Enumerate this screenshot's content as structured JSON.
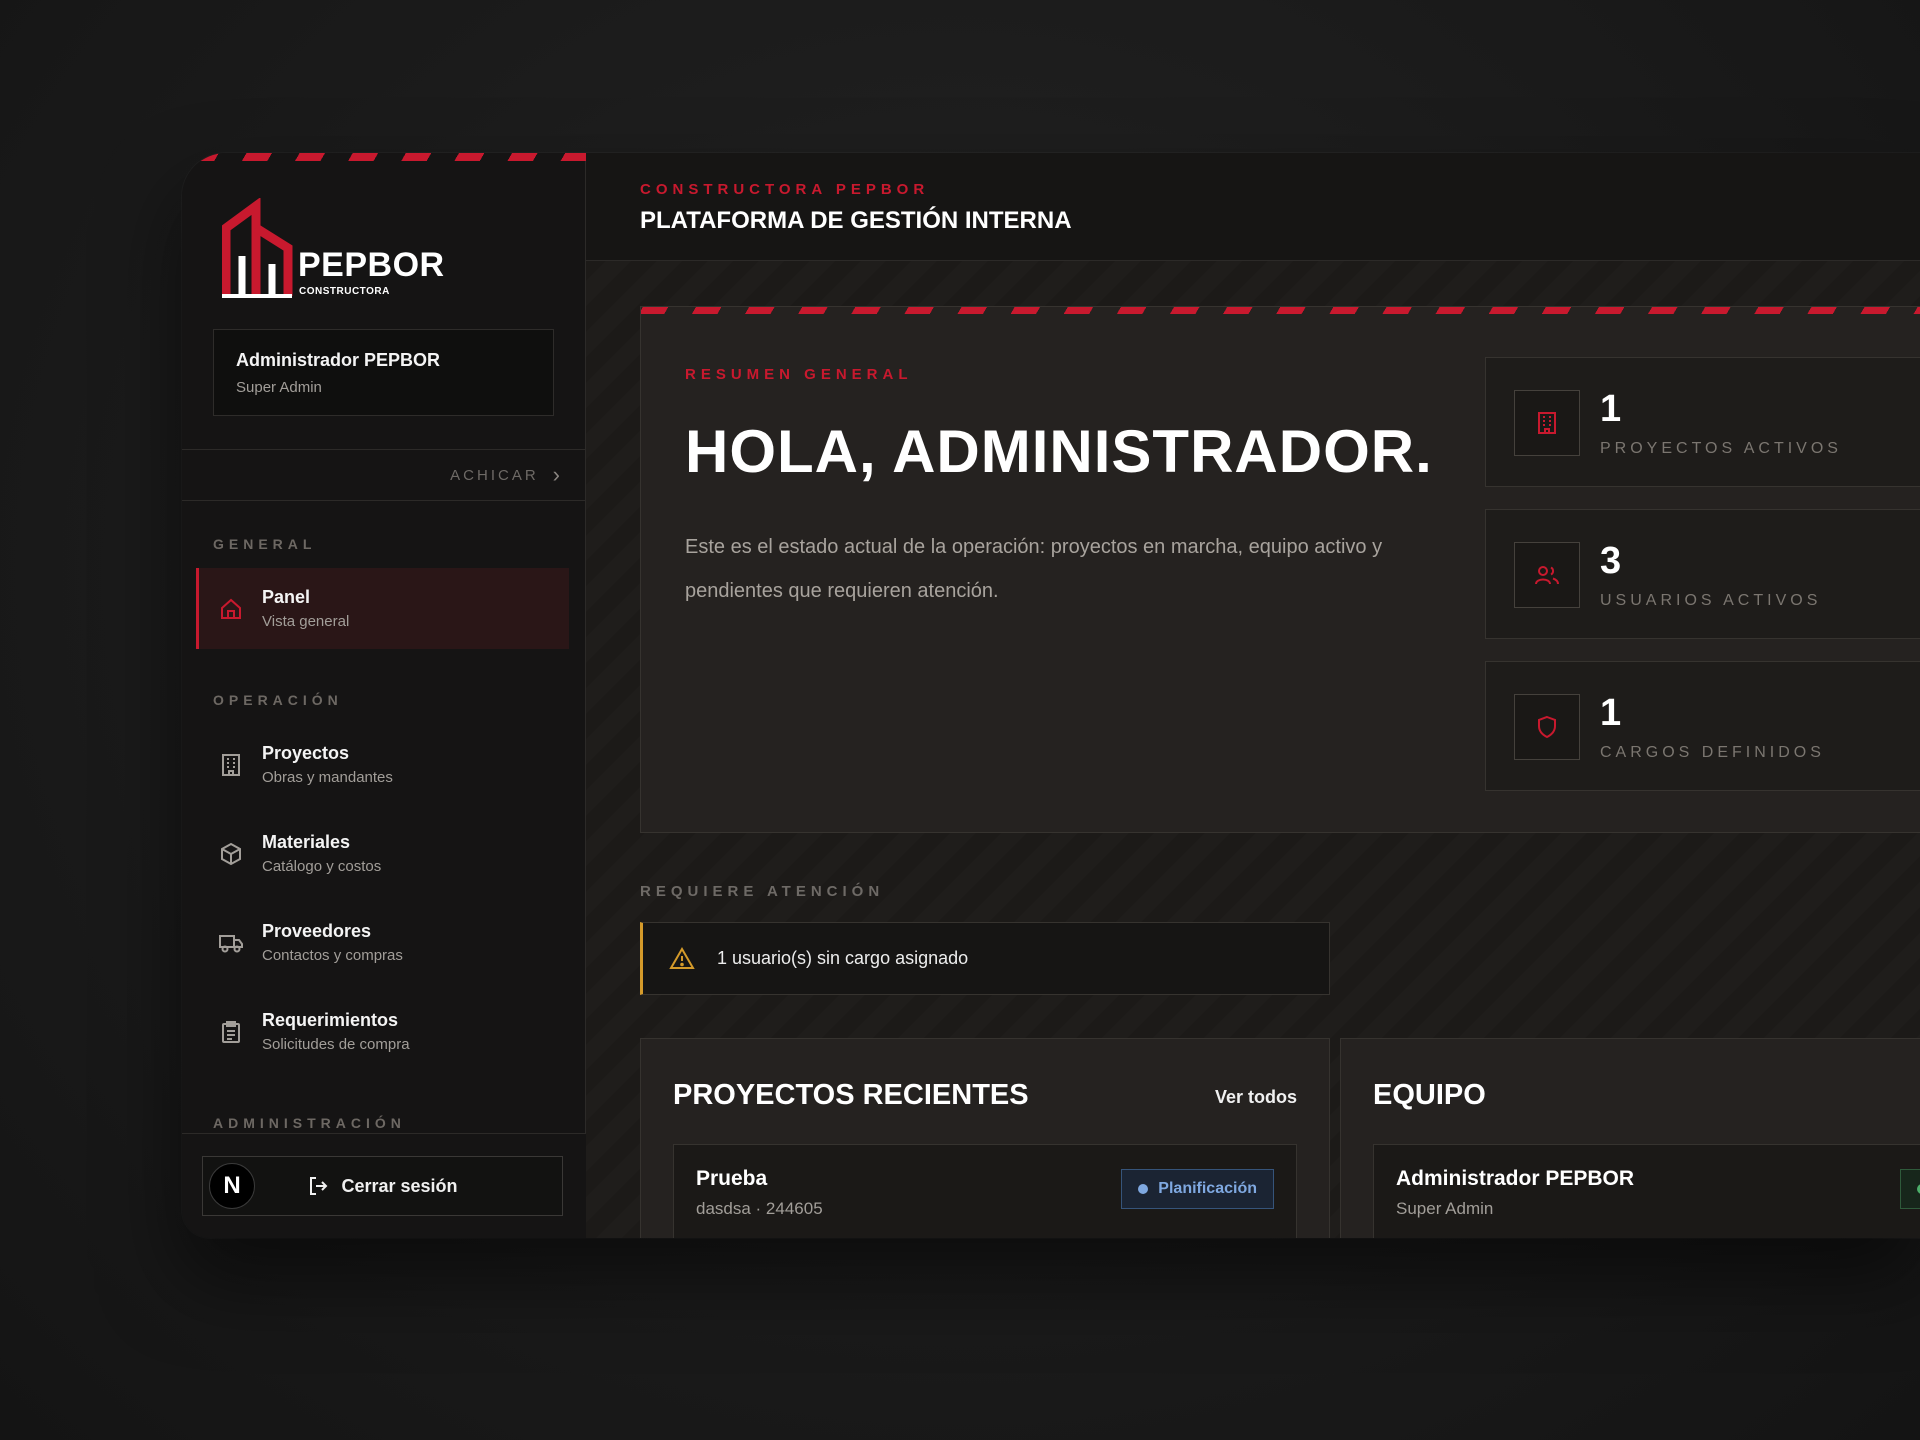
{
  "brand": {
    "wordmark": "PEPBOR",
    "tagline": "CONSTRUCTORA",
    "accent": "#c8192e"
  },
  "user": {
    "name": "Administrador PEPBOR",
    "role": "Super Admin"
  },
  "sidebar": {
    "collapse_label": "ACHICAR",
    "sections": {
      "general": "GENERAL",
      "operacion": "OPERACIÓN",
      "administracion": "ADMINISTRACIÓN"
    },
    "items": [
      {
        "title": "Panel",
        "subtitle": "Vista general",
        "icon": "home-icon",
        "active": true
      },
      {
        "title": "Proyectos",
        "subtitle": "Obras y mandantes",
        "icon": "building-icon"
      },
      {
        "title": "Materiales",
        "subtitle": "Catálogo y costos",
        "icon": "box-icon"
      },
      {
        "title": "Proveedores",
        "subtitle": "Contactos y compras",
        "icon": "truck-icon"
      },
      {
        "title": "Requerimientos",
        "subtitle": "Solicitudes de compra",
        "icon": "clipboard-icon"
      }
    ],
    "avatar_letter": "N",
    "logout_label": "Cerrar sesión"
  },
  "header": {
    "kicker": "CONSTRUCTORA PEPBOR",
    "title": "PLATAFORMA DE GESTIÓN INTERNA"
  },
  "hero": {
    "kicker": "RESUMEN GENERAL",
    "greeting": "HOLA, ADMINISTRADOR.",
    "description": "Este es el estado actual de la operación: proyectos en marcha, equipo activo y pendientes que requieren atención."
  },
  "stats": [
    {
      "value": "1",
      "label": "PROYECTOS ACTIVOS",
      "icon": "building-icon"
    },
    {
      "value": "3",
      "label": "USUARIOS ACTIVOS",
      "icon": "users-icon"
    },
    {
      "value": "1",
      "label": "CARGOS DEFINIDOS",
      "icon": "shield-icon"
    }
  ],
  "attention": {
    "label": "REQUIERE ATENCIÓN",
    "items": [
      {
        "text": "1 usuario(s) sin cargo asignado",
        "icon": "warning-icon",
        "color": "#d49a2a"
      }
    ]
  },
  "recent_projects": {
    "title": "PROYECTOS RECIENTES",
    "link": "Ver todos",
    "items": [
      {
        "name": "Prueba",
        "meta": "dasdsa · 244605",
        "status": "Planificación",
        "status_color": "#7fa8e0"
      }
    ]
  },
  "team": {
    "title": "EQUIPO",
    "members": [
      {
        "name": "Administrador PEPBOR",
        "role": "Super Admin",
        "status": "A",
        "status_color": "#4caf6a"
      }
    ]
  }
}
